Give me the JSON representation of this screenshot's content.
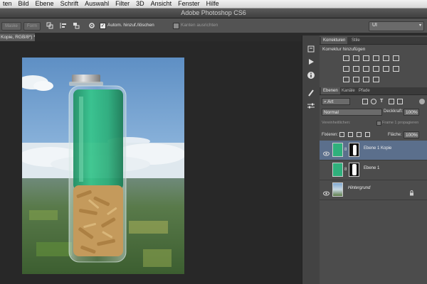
{
  "menubar": {
    "items": [
      "ten",
      "Bild",
      "Ebene",
      "Schrift",
      "Auswahl",
      "Filter",
      "3D",
      "Ansicht",
      "Fenster",
      "Hilfe"
    ]
  },
  "window": {
    "title": "Adobe Photoshop CS6"
  },
  "options_bar": {
    "btn1": "Maske",
    "btn2": "Form",
    "auto_select_label": "Autom. hinzuf./löschen",
    "align_edges_label": "Kanten ausrichten",
    "workspace": "UI"
  },
  "document": {
    "tab_label": "Kopie, RGB/8*) *"
  },
  "panels": {
    "adjustments": {
      "tabs": [
        "Korrekturen",
        "Stile"
      ],
      "heading": "Korrektur hinzufügen"
    },
    "layers": {
      "tabs": [
        "Ebenen",
        "Kanäle",
        "Pfade"
      ],
      "filter_kind": "Art",
      "blend_mode": "Normal",
      "opacity_label": "Deckkraft:",
      "opacity_value": "100%",
      "unify_label": "Vereinheitlichen:",
      "propagate_label": "Frame 1 propagieren",
      "lock_label": "Fixieren:",
      "fill_label": "Fläche:",
      "fill_value": "100%",
      "items": [
        {
          "name": "Ebene 1 Kopie",
          "selected": true,
          "visible": true
        },
        {
          "name": "Ebene 1",
          "selected": false,
          "visible": false
        },
        {
          "name": "Hintergrund",
          "selected": false,
          "visible": true,
          "italic": true,
          "locked": true
        }
      ]
    }
  },
  "colors": {
    "selected_layer": "#5b6f8c",
    "ui_dark": "#2b2b2b",
    "panel": "#4c4c4c"
  }
}
